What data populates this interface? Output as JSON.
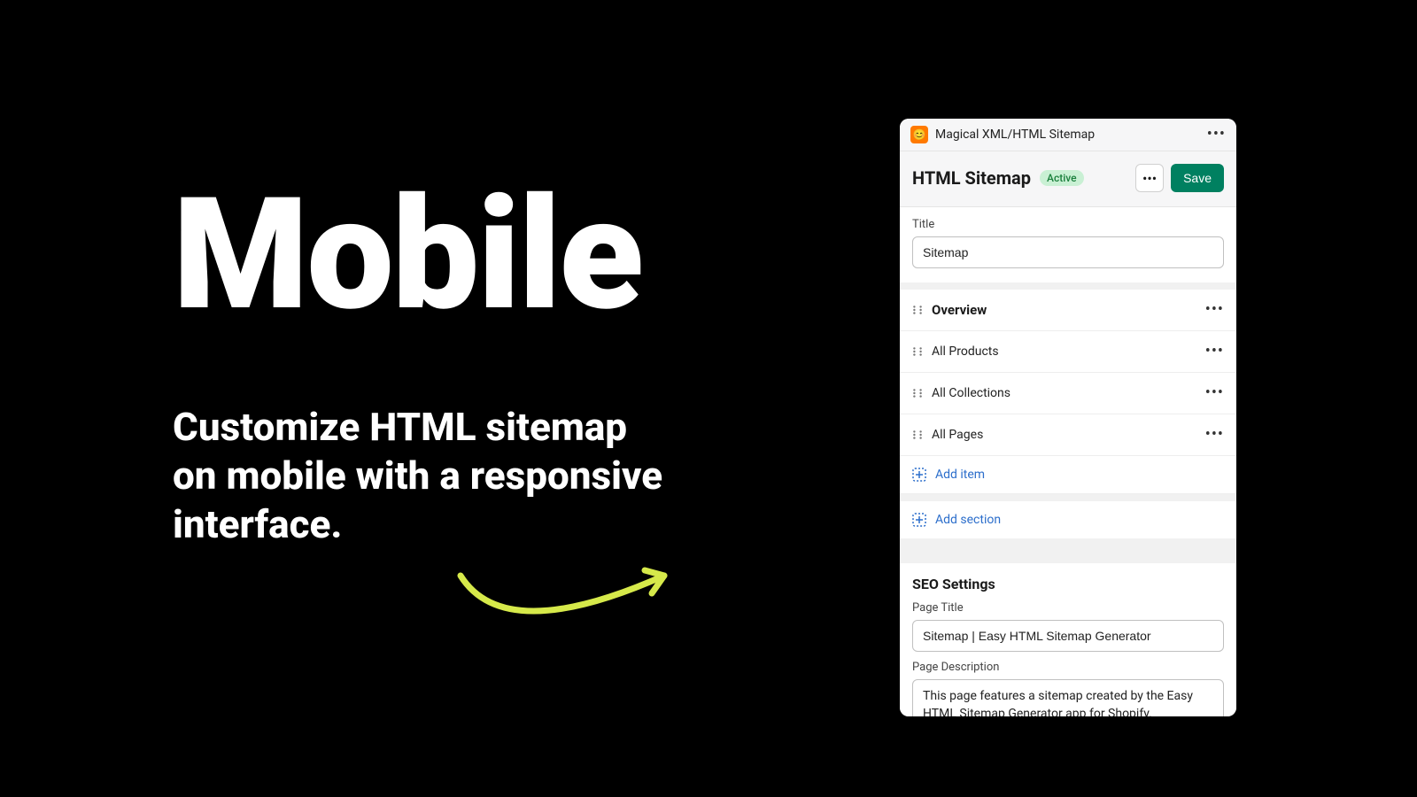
{
  "promo": {
    "title": "Mobile",
    "subtitle": "Customize HTML sitemap on mobile with a responsive interface."
  },
  "appbar": {
    "app_name": "Magical XML/HTML Sitemap",
    "app_icon_glyph": "😊"
  },
  "header": {
    "title": "HTML Sitemap",
    "badge": "Active",
    "save_label": "Save"
  },
  "title_field": {
    "label": "Title",
    "value": "Sitemap"
  },
  "sections": {
    "overview": "Overview",
    "items": [
      {
        "label": "All Products"
      },
      {
        "label": "All Collections"
      },
      {
        "label": "All Pages"
      }
    ],
    "add_item": "Add item",
    "add_section": "Add section"
  },
  "seo": {
    "heading": "SEO Settings",
    "page_title_label": "Page Title",
    "page_title_value": "Sitemap | Easy HTML Sitemap Generator",
    "page_desc_label": "Page Description",
    "page_desc_value": "This page features a sitemap created by the Easy HTML Sitemap Generator app for Shopify."
  },
  "colors": {
    "accent_green": "#008060",
    "badge_bg": "#c9f0d4",
    "link_blue": "#2c6ecb",
    "arrow": "#d6e94a"
  }
}
